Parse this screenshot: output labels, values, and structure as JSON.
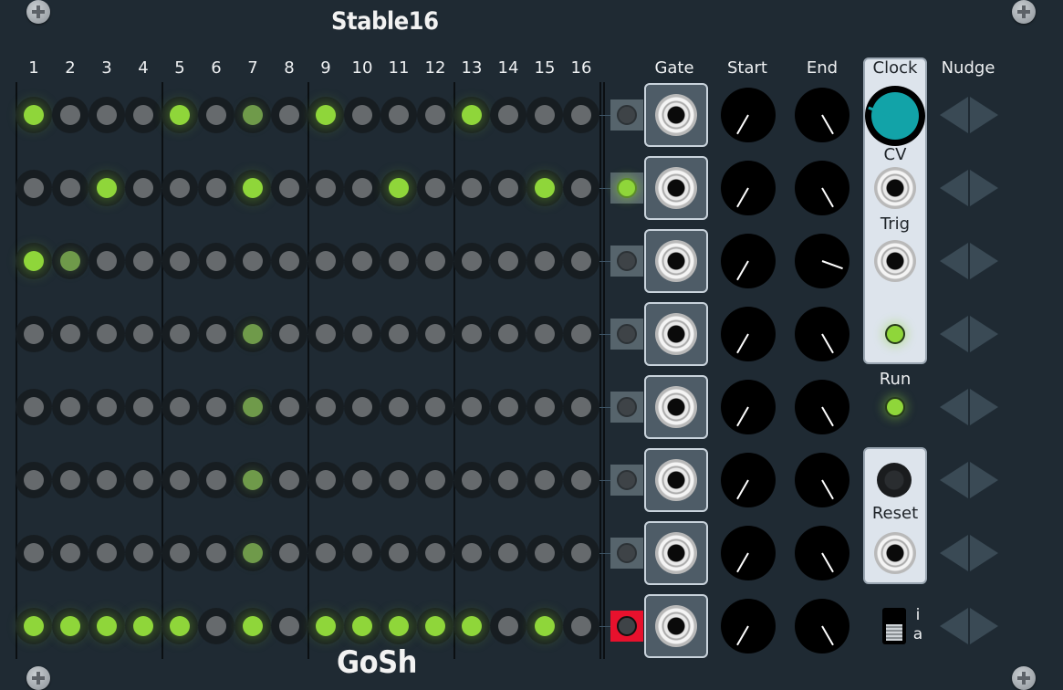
{
  "module": {
    "title": "Stable16",
    "brand": "GoSh"
  },
  "columns": [
    "1",
    "2",
    "3",
    "4",
    "5",
    "6",
    "7",
    "8",
    "9",
    "10",
    "11",
    "12",
    "13",
    "14",
    "15",
    "16"
  ],
  "headers": {
    "gate": "Gate",
    "start": "Start",
    "end": "End",
    "clock": "Clock",
    "nudge": "Nudge"
  },
  "clock_panel": {
    "cv": "CV",
    "trig": "Trig"
  },
  "run_label": "Run",
  "reset_label": "Reset",
  "switch_labels": {
    "top": "i",
    "bottom": "a"
  },
  "grid": [
    [
      "on",
      "off",
      "off",
      "off",
      "on",
      "off",
      "dim",
      "off",
      "on",
      "off",
      "off",
      "off",
      "on",
      "off",
      "off",
      "off"
    ],
    [
      "off",
      "off",
      "on",
      "off",
      "off",
      "off",
      "on",
      "off",
      "off",
      "off",
      "on",
      "off",
      "off",
      "off",
      "on",
      "off"
    ],
    [
      "on",
      "dim",
      "off",
      "off",
      "off",
      "off",
      "off",
      "off",
      "off",
      "off",
      "off",
      "off",
      "off",
      "off",
      "off",
      "off"
    ],
    [
      "off",
      "off",
      "off",
      "off",
      "off",
      "off",
      "dim",
      "off",
      "off",
      "off",
      "off",
      "off",
      "off",
      "off",
      "off",
      "off"
    ],
    [
      "off",
      "off",
      "off",
      "off",
      "off",
      "off",
      "dim",
      "off",
      "off",
      "off",
      "off",
      "off",
      "off",
      "off",
      "off",
      "off"
    ],
    [
      "off",
      "off",
      "off",
      "off",
      "off",
      "off",
      "dim",
      "off",
      "off",
      "off",
      "off",
      "off",
      "off",
      "off",
      "off",
      "off"
    ],
    [
      "off",
      "off",
      "off",
      "off",
      "off",
      "off",
      "dim",
      "off",
      "off",
      "off",
      "off",
      "off",
      "off",
      "off",
      "off",
      "off"
    ],
    [
      "on",
      "on",
      "on",
      "on",
      "on",
      "off",
      "on",
      "off",
      "on",
      "on",
      "on",
      "on",
      "on",
      "off",
      "on",
      "off"
    ]
  ],
  "row_indicators": [
    "off",
    "lit",
    "off",
    "off",
    "off",
    "off",
    "off",
    "red"
  ],
  "start_knobs_deg": [
    -150,
    -150,
    -150,
    -150,
    -150,
    -150,
    -150,
    -150
  ],
  "end_knobs_deg": [
    150,
    150,
    -250,
    150,
    150,
    150,
    150,
    150
  ],
  "colors": {
    "led_on": "#8fd63a",
    "led_dim": "#6f9a4a",
    "led_off": "#666a6d",
    "clock_knob": "#12a3a8",
    "reset_indicator": "#e8112d",
    "panel": "#1f2a33"
  }
}
